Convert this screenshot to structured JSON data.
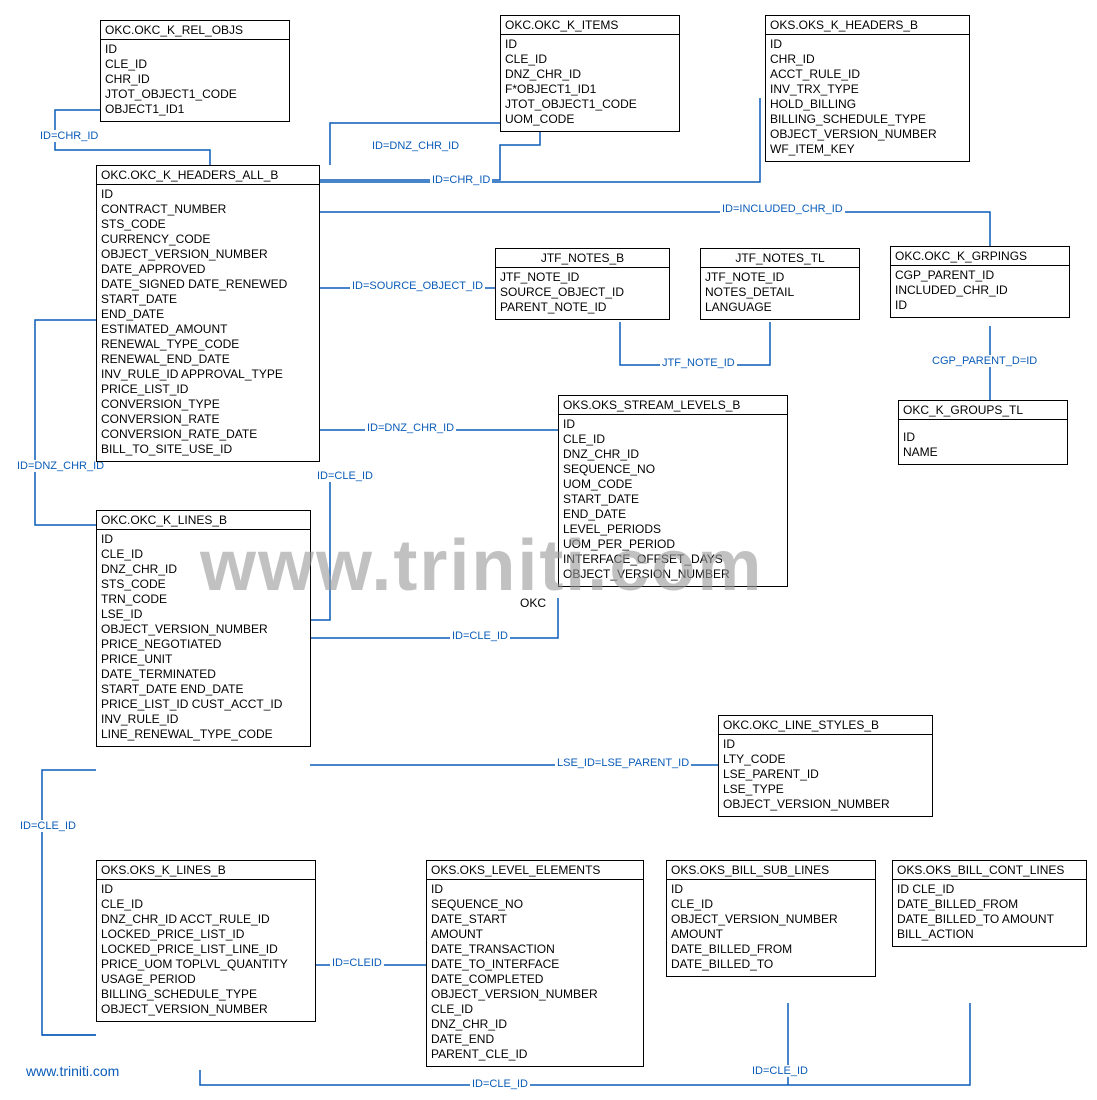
{
  "watermark": "www.triniti.com",
  "footer_link": "www.triniti.com",
  "entities": {
    "okc_k_rel_objs": {
      "title": "OKC.OKC_K_REL_OBJS",
      "fields": [
        "ID",
        "CLE_ID",
        "CHR_ID",
        "JTOT_OBJECT1_CODE",
        "OBJECT1_ID1"
      ]
    },
    "okc_k_items": {
      "title": "OKC.OKC_K_ITEMS",
      "fields": [
        "ID",
        "CLE_ID",
        "DNZ_CHR_ID",
        "F*OBJECT1_ID1",
        "JTOT_OBJECT1_CODE",
        "UOM_CODE"
      ]
    },
    "oks_k_headers_b": {
      "title": "OKS.OKS_K_HEADERS_B",
      "fields": [
        "ID",
        "CHR_ID",
        "ACCT_RULE_ID",
        "INV_TRX_TYPE",
        "HOLD_BILLING",
        "BILLING_SCHEDULE_TYPE",
        "OBJECT_VERSION_NUMBER",
        "WF_ITEM_KEY"
      ]
    },
    "okc_k_headers_all_b": {
      "title": "OKC.OKC_K_HEADERS_ALL_B",
      "fields": [
        "ID",
        "CONTRACT_NUMBER",
        "STS_CODE",
        "CURRENCY_CODE",
        "OBJECT_VERSION_NUMBER",
        "DATE_APPROVED",
        "DATE_SIGNED DATE_RENEWED",
        "START_DATE",
        "END_DATE",
        "ESTIMATED_AMOUNT",
        "RENEWAL_TYPE_CODE",
        "RENEWAL_END_DATE",
        "INV_RULE_ID APPROVAL_TYPE",
        "PRICE_LIST_ID",
        "CONVERSION_TYPE",
        "CONVERSION_RATE",
        "CONVERSION_RATE_DATE",
        "BILL_TO_SITE_USE_ID"
      ]
    },
    "jtf_notes_b": {
      "title": "JTF_NOTES_B",
      "fields": [
        "JTF_NOTE_ID",
        "SOURCE_OBJECT_ID",
        "PARENT_NOTE_ID"
      ]
    },
    "jtf_notes_tl": {
      "title": "JTF_NOTES_TL",
      "fields": [
        "JTF_NOTE_ID",
        "NOTES_DETAIL",
        "LANGUAGE"
      ]
    },
    "okc_k_grpings": {
      "title": "OKC.OKC_K_GRPINGS",
      "fields": [
        "CGP_PARENT_ID",
        "INCLUDED_CHR_ID",
        "ID"
      ]
    },
    "oks_stream_levels_b": {
      "title": "OKS.OKS_STREAM_LEVELS_B",
      "fields": [
        "ID",
        "CLE_ID",
        "DNZ_CHR_ID",
        "SEQUENCE_NO",
        "UOM_CODE",
        "START_DATE",
        "END_DATE",
        "LEVEL_PERIODS",
        "UOM_PER_PERIOD",
        "INTERFACE_OFFSET_DAYS",
        "OBJECT_VERSION_NUMBER"
      ]
    },
    "okc_k_groups_tl": {
      "title": "OKC_K_GROUPS_TL",
      "fields": [
        "ID",
        "NAME"
      ]
    },
    "okc_k_lines_b": {
      "title": "OKC.OKC_K_LINES_B",
      "fields": [
        "ID",
        "CLE_ID",
        "DNZ_CHR_ID",
        "STS_CODE",
        "TRN_CODE",
        "LSE_ID",
        "OBJECT_VERSION_NUMBER",
        "PRICE_NEGOTIATED",
        "PRICE_UNIT",
        "DATE_TERMINATED",
        "START_DATE END_DATE",
        "PRICE_LIST_ID CUST_ACCT_ID",
        "INV_RULE_ID",
        "LINE_RENEWAL_TYPE_CODE"
      ]
    },
    "okc_line_styles_b": {
      "title": "OKC.OKC_LINE_STYLES_B",
      "fields": [
        "ID",
        "LTY_CODE",
        "LSE_PARENT_ID",
        "LSE_TYPE",
        "OBJECT_VERSION_NUMBER"
      ]
    },
    "oks_k_lines_b": {
      "title": "OKS.OKS_K_LINES_B",
      "fields": [
        "ID",
        "CLE_ID",
        "DNZ_CHR_ID ACCT_RULE_ID",
        "LOCKED_PRICE_LIST_ID",
        "LOCKED_PRICE_LIST_LINE_ID",
        "PRICE_UOM TOPLVL_QUANTITY",
        "USAGE_PERIOD",
        "BILLING_SCHEDULE_TYPE",
        "OBJECT_VERSION_NUMBER"
      ]
    },
    "oks_level_elements": {
      "title": "OKS.OKS_LEVEL_ELEMENTS",
      "fields": [
        "ID",
        "SEQUENCE_NO",
        "DATE_START",
        "AMOUNT",
        "DATE_TRANSACTION",
        "DATE_TO_INTERFACE",
        "DATE_COMPLETED",
        "OBJECT_VERSION_NUMBER",
        "CLE_ID",
        "DNZ_CHR_ID",
        "DATE_END",
        "PARENT_CLE_ID"
      ]
    },
    "oks_bill_sub_lines": {
      "title": "OKS.OKS_BILL_SUB_LINES",
      "fields": [
        "ID",
        "CLE_ID",
        "OBJECT_VERSION_NUMBER",
        "AMOUNT",
        "DATE_BILLED_FROM",
        "DATE_BILLED_TO"
      ]
    },
    "oks_bill_cont_lines": {
      "title": "OKS.OKS_BILL_CONT_LINES",
      "fields": [
        "ID CLE_ID",
        "DATE_BILLED_FROM",
        "DATE_BILLED_TO AMOUNT",
        "BILL_ACTION"
      ]
    }
  },
  "rel_labels": {
    "r1": "ID=CHR_ID",
    "r2": "ID=DNZ_CHR_ID",
    "r3": "ID=CHR_ID",
    "r4": "ID=INCLUDED_CHR_ID",
    "r5": "ID=SOURCE_OBJECT_ID",
    "r6": "JTF_NOTE_ID",
    "r7": "CGP_PARENT_D=ID",
    "r8": "ID=DNZ_CHR_ID",
    "r9": "ID=CLE_ID",
    "r10": "ID=DNZ_CHR_ID",
    "r11": "ID=CLE_ID",
    "r12": "LSE_ID=LSE_PARENT_ID",
    "r13": "ID=CLE_ID",
    "r14": "ID=CLEID",
    "r15": "ID=CLE_ID",
    "r16": "ID=CLE_ID"
  },
  "misc": {
    "okc_label": "OKC"
  }
}
